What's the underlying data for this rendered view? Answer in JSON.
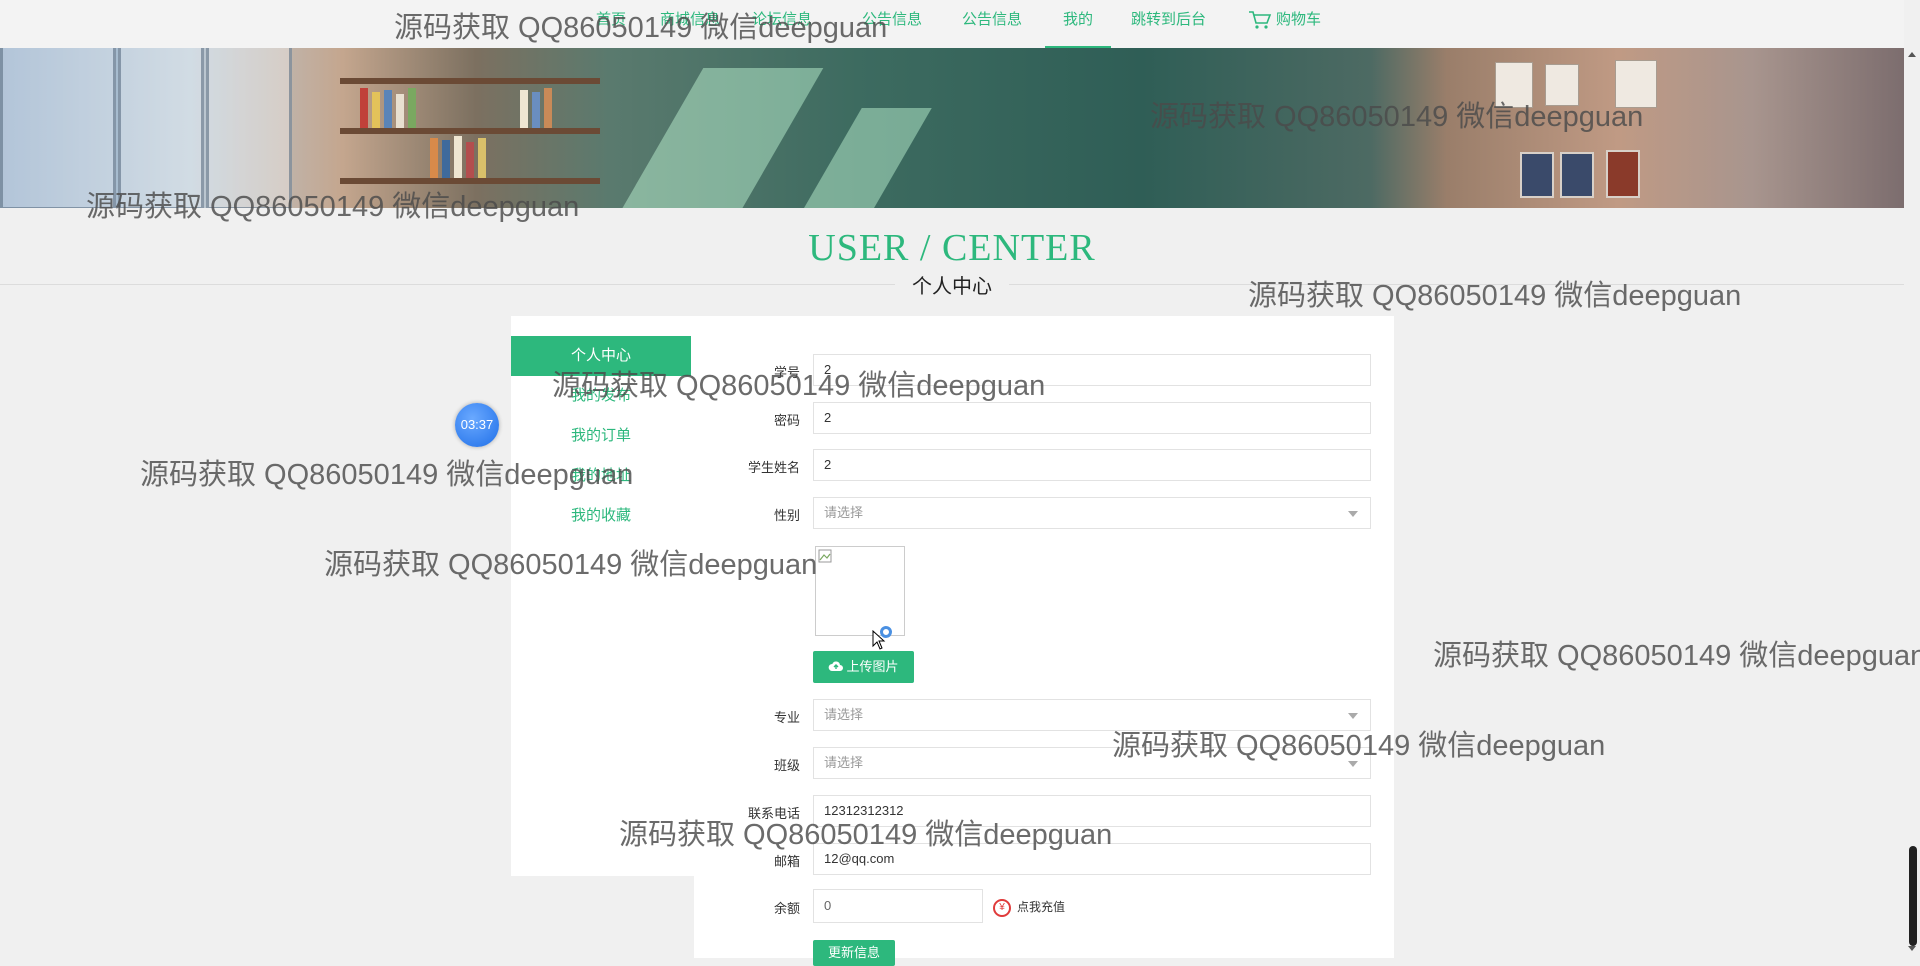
{
  "nav": {
    "items": [
      {
        "label": "首页"
      },
      {
        "label": "商城信息"
      },
      {
        "label": "论坛信息"
      },
      {
        "label": "公告信息"
      },
      {
        "label": "我的"
      },
      {
        "label": "跳转到后台"
      }
    ],
    "cart_label": "购物车",
    "cart_icon": "cart-icon",
    "active_item": "我的",
    "accent_color": "#2db87d"
  },
  "header": {
    "title_en": "USER / CENTER",
    "title_cn": "个人中心"
  },
  "sidebar": {
    "items": [
      {
        "label": "个人中心"
      },
      {
        "label": "我的发布"
      },
      {
        "label": "我的订单"
      },
      {
        "label": "我的地址"
      },
      {
        "label": "我的收藏"
      }
    ],
    "active_item": "个人中心"
  },
  "form": {
    "student_no": {
      "label": "学号",
      "value": "2"
    },
    "password": {
      "label": "密码",
      "value": "2"
    },
    "student_name": {
      "label": "学生姓名",
      "value": "2"
    },
    "gender": {
      "label": "性别",
      "placeholder": "请选择"
    },
    "upload_label": "上传图片",
    "major": {
      "label": "专业",
      "placeholder": "请选择"
    },
    "class": {
      "label": "班级",
      "placeholder": "请选择"
    },
    "phone": {
      "label": "联系电话",
      "value": "12312312312"
    },
    "email": {
      "label": "邮箱",
      "value": "12@qq.com"
    },
    "balance": {
      "label": "余额",
      "value": "0"
    },
    "recharge_label": "点我充值",
    "update_label": "更新信息"
  },
  "timer": {
    "text": "03:37"
  },
  "watermark": "源码获取 QQ86050149 微信deepguan"
}
